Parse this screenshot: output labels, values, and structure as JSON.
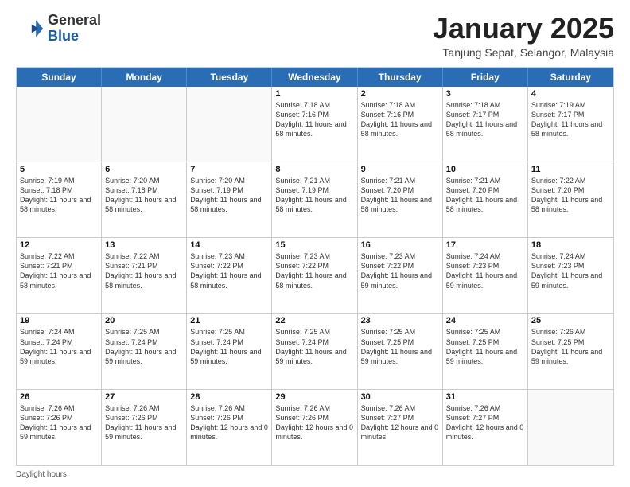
{
  "header": {
    "logo_general": "General",
    "logo_blue": "Blue",
    "month_title": "January 2025",
    "location": "Tanjung Sepat, Selangor, Malaysia"
  },
  "weekdays": [
    "Sunday",
    "Monday",
    "Tuesday",
    "Wednesday",
    "Thursday",
    "Friday",
    "Saturday"
  ],
  "rows": [
    [
      {
        "num": "",
        "text": "",
        "empty": true
      },
      {
        "num": "",
        "text": "",
        "empty": true
      },
      {
        "num": "",
        "text": "",
        "empty": true
      },
      {
        "num": "1",
        "text": "Sunrise: 7:18 AM\nSunset: 7:16 PM\nDaylight: 11 hours and 58 minutes."
      },
      {
        "num": "2",
        "text": "Sunrise: 7:18 AM\nSunset: 7:16 PM\nDaylight: 11 hours and 58 minutes."
      },
      {
        "num": "3",
        "text": "Sunrise: 7:18 AM\nSunset: 7:17 PM\nDaylight: 11 hours and 58 minutes."
      },
      {
        "num": "4",
        "text": "Sunrise: 7:19 AM\nSunset: 7:17 PM\nDaylight: 11 hours and 58 minutes."
      }
    ],
    [
      {
        "num": "5",
        "text": "Sunrise: 7:19 AM\nSunset: 7:18 PM\nDaylight: 11 hours and 58 minutes."
      },
      {
        "num": "6",
        "text": "Sunrise: 7:20 AM\nSunset: 7:18 PM\nDaylight: 11 hours and 58 minutes."
      },
      {
        "num": "7",
        "text": "Sunrise: 7:20 AM\nSunset: 7:19 PM\nDaylight: 11 hours and 58 minutes."
      },
      {
        "num": "8",
        "text": "Sunrise: 7:21 AM\nSunset: 7:19 PM\nDaylight: 11 hours and 58 minutes."
      },
      {
        "num": "9",
        "text": "Sunrise: 7:21 AM\nSunset: 7:20 PM\nDaylight: 11 hours and 58 minutes."
      },
      {
        "num": "10",
        "text": "Sunrise: 7:21 AM\nSunset: 7:20 PM\nDaylight: 11 hours and 58 minutes."
      },
      {
        "num": "11",
        "text": "Sunrise: 7:22 AM\nSunset: 7:20 PM\nDaylight: 11 hours and 58 minutes."
      }
    ],
    [
      {
        "num": "12",
        "text": "Sunrise: 7:22 AM\nSunset: 7:21 PM\nDaylight: 11 hours and 58 minutes."
      },
      {
        "num": "13",
        "text": "Sunrise: 7:22 AM\nSunset: 7:21 PM\nDaylight: 11 hours and 58 minutes."
      },
      {
        "num": "14",
        "text": "Sunrise: 7:23 AM\nSunset: 7:22 PM\nDaylight: 11 hours and 58 minutes."
      },
      {
        "num": "15",
        "text": "Sunrise: 7:23 AM\nSunset: 7:22 PM\nDaylight: 11 hours and 58 minutes."
      },
      {
        "num": "16",
        "text": "Sunrise: 7:23 AM\nSunset: 7:22 PM\nDaylight: 11 hours and 59 minutes."
      },
      {
        "num": "17",
        "text": "Sunrise: 7:24 AM\nSunset: 7:23 PM\nDaylight: 11 hours and 59 minutes."
      },
      {
        "num": "18",
        "text": "Sunrise: 7:24 AM\nSunset: 7:23 PM\nDaylight: 11 hours and 59 minutes."
      }
    ],
    [
      {
        "num": "19",
        "text": "Sunrise: 7:24 AM\nSunset: 7:24 PM\nDaylight: 11 hours and 59 minutes."
      },
      {
        "num": "20",
        "text": "Sunrise: 7:25 AM\nSunset: 7:24 PM\nDaylight: 11 hours and 59 minutes."
      },
      {
        "num": "21",
        "text": "Sunrise: 7:25 AM\nSunset: 7:24 PM\nDaylight: 11 hours and 59 minutes."
      },
      {
        "num": "22",
        "text": "Sunrise: 7:25 AM\nSunset: 7:24 PM\nDaylight: 11 hours and 59 minutes."
      },
      {
        "num": "23",
        "text": "Sunrise: 7:25 AM\nSunset: 7:25 PM\nDaylight: 11 hours and 59 minutes."
      },
      {
        "num": "24",
        "text": "Sunrise: 7:25 AM\nSunset: 7:25 PM\nDaylight: 11 hours and 59 minutes."
      },
      {
        "num": "25",
        "text": "Sunrise: 7:26 AM\nSunset: 7:25 PM\nDaylight: 11 hours and 59 minutes."
      }
    ],
    [
      {
        "num": "26",
        "text": "Sunrise: 7:26 AM\nSunset: 7:26 PM\nDaylight: 11 hours and 59 minutes."
      },
      {
        "num": "27",
        "text": "Sunrise: 7:26 AM\nSunset: 7:26 PM\nDaylight: 11 hours and 59 minutes."
      },
      {
        "num": "28",
        "text": "Sunrise: 7:26 AM\nSunset: 7:26 PM\nDaylight: 12 hours and 0 minutes."
      },
      {
        "num": "29",
        "text": "Sunrise: 7:26 AM\nSunset: 7:26 PM\nDaylight: 12 hours and 0 minutes."
      },
      {
        "num": "30",
        "text": "Sunrise: 7:26 AM\nSunset: 7:27 PM\nDaylight: 12 hours and 0 minutes."
      },
      {
        "num": "31",
        "text": "Sunrise: 7:26 AM\nSunset: 7:27 PM\nDaylight: 12 hours and 0 minutes."
      },
      {
        "num": "",
        "text": "",
        "empty": true
      }
    ]
  ],
  "footer": {
    "daylight_label": "Daylight hours"
  }
}
